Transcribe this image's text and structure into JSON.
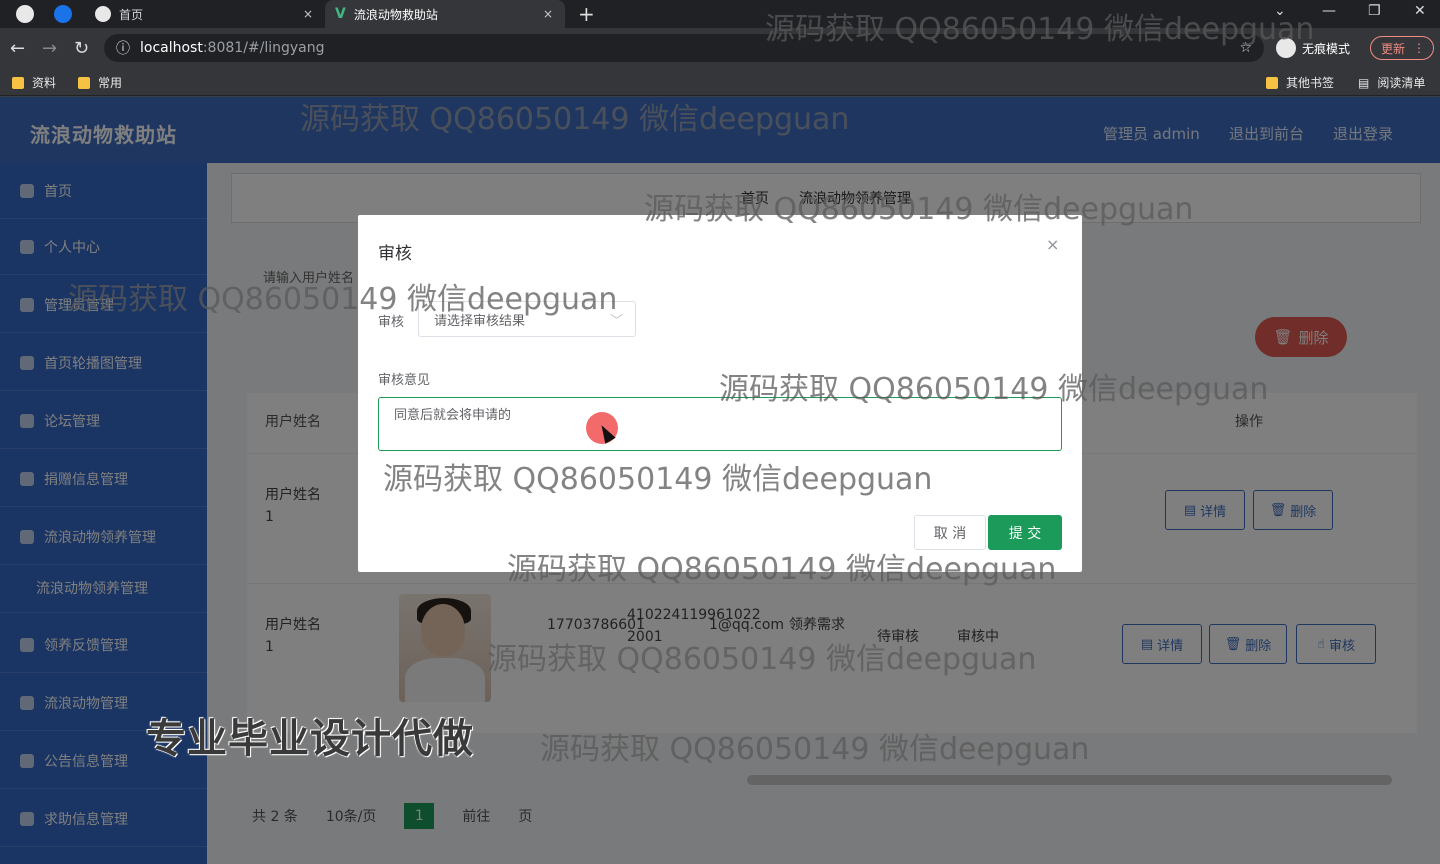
{
  "browser": {
    "tabs": [
      {
        "title": "首页",
        "close": "×"
      },
      {
        "title": "流浪动物救助站",
        "close": "×",
        "logo": "V"
      }
    ],
    "new_tab": "+",
    "window_controls": [
      "⌄",
      "—",
      "❐",
      "✕"
    ],
    "url_host": "localhost",
    "url_path": ":8081/#/lingyang",
    "incognito_label": "无痕模式",
    "update_label": "更新",
    "bookmarks": [
      "资料",
      "常用"
    ],
    "bookmarks_right": [
      "其他书签",
      "阅读清单"
    ]
  },
  "app": {
    "title": "流浪动物救助站",
    "header_links": [
      "管理员 admin",
      "退出到前台",
      "退出登录"
    ],
    "sidebar": [
      {
        "label": "首页"
      },
      {
        "label": "个人中心"
      },
      {
        "label": "管理员管理"
      },
      {
        "label": "首页轮播图管理"
      },
      {
        "label": "论坛管理"
      },
      {
        "label": "捐赠信息管理"
      },
      {
        "label": "流浪动物领养管理"
      },
      {
        "label": "流浪动物领养管理"
      },
      {
        "label": "领养反馈管理"
      },
      {
        "label": "流浪动物管理"
      },
      {
        "label": "公告信息管理"
      },
      {
        "label": "求助信息管理"
      }
    ],
    "breadcrumb": [
      "首页",
      "流浪动物领养管理"
    ],
    "search_label": "请输入用户姓名",
    "delete_all": "删除",
    "table": {
      "headers": {
        "user": "用户姓名",
        "op": "操作"
      },
      "rows": [
        {
          "user": "用户姓名1",
          "buttons": [
            "详情",
            "删除"
          ]
        },
        {
          "user": "用户姓名1",
          "phone": "17703786601",
          "idcard": "410224119961022 2001",
          "email": "1@qq.com",
          "need": "领养需求",
          "status1": "待审核",
          "status2": "审核中",
          "buttons": [
            "详情",
            "删除",
            "审核"
          ]
        }
      ]
    },
    "pager": {
      "total": "共 2 条",
      "per_page": "10条/页",
      "current": "1",
      "goto": "前往",
      "page_unit": "页"
    }
  },
  "dialog": {
    "title": "审核",
    "close": "×",
    "audit_label": "审核",
    "audit_placeholder": "请选择审核结果",
    "opinion_label": "审核意见",
    "opinion_value": "同意后就会将申请的",
    "cancel_label": "取 消",
    "submit_label": "提 交"
  },
  "watermarks": {
    "text": "源码获取 QQ86050149 微信deepguan",
    "banner": "专业毕业设计代做"
  }
}
